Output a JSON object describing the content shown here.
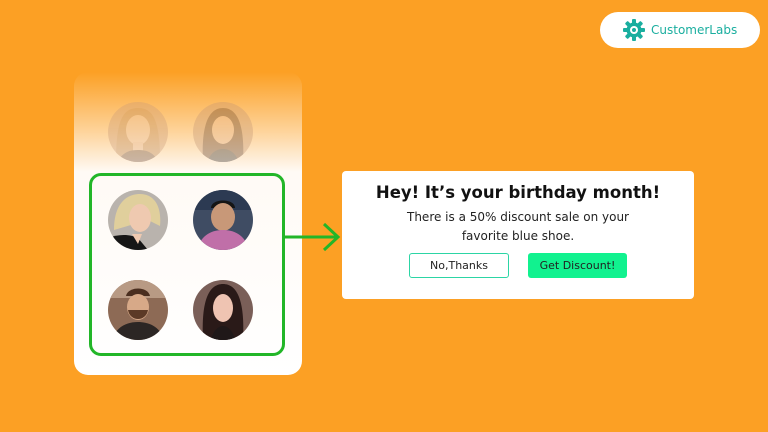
{
  "brand": {
    "name": "CustomerLabs",
    "icon": "gear-icon",
    "color": "#1AAE9F"
  },
  "background_color": "#FCA024",
  "audience_panel": {
    "avatars_faded": [
      {
        "icon": "woman-blonde-avatar"
      },
      {
        "icon": "woman-brunette-avatar"
      }
    ],
    "avatars_selected": [
      {
        "icon": "woman-blonde-selfie-avatar"
      },
      {
        "icon": "man-pink-shirt-avatar"
      },
      {
        "icon": "man-bearded-avatar"
      },
      {
        "icon": "woman-dark-hair-avatar"
      }
    ],
    "selection_color": "#22B628"
  },
  "arrow": {
    "icon": "arrow-right-icon",
    "color": "#22B628"
  },
  "popup": {
    "title": "Hey! It’s your birthday month!",
    "body_line1": "There is a 50% discount sale on your",
    "body_line2": "favorite blue shoe.",
    "decline_label": "No,Thanks",
    "accept_label": "Get Discount!",
    "accept_color": "#11F28F",
    "decline_border_color": "#2CD5A5"
  }
}
